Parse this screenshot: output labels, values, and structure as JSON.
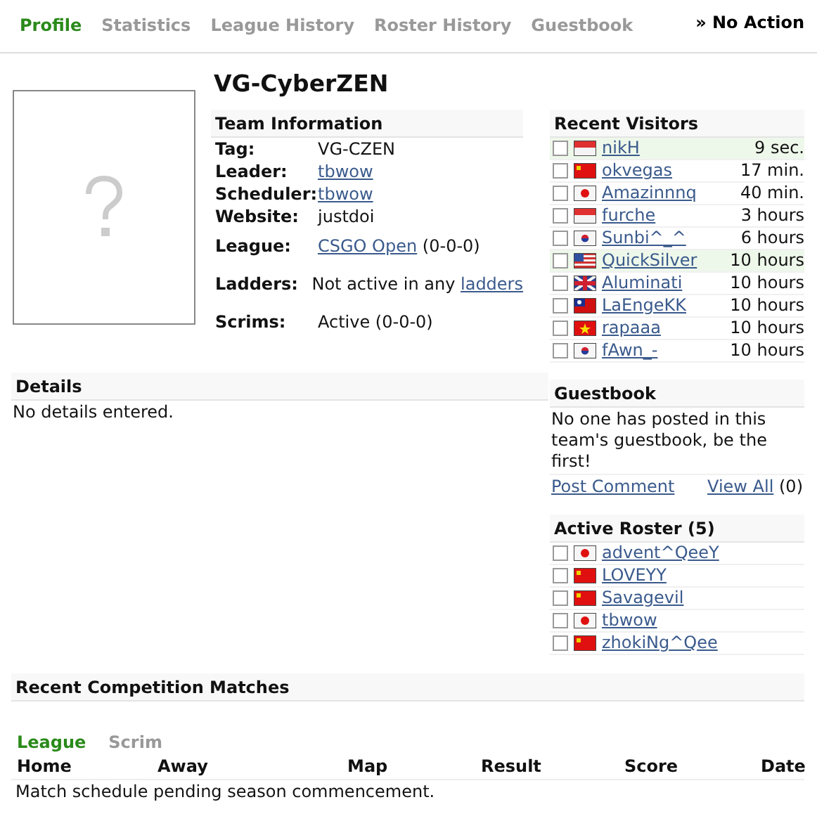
{
  "tabs": [
    {
      "label": "Profile",
      "selected": true
    },
    {
      "label": "Statistics",
      "selected": false
    },
    {
      "label": "League History",
      "selected": false
    },
    {
      "label": "Roster History",
      "selected": false
    },
    {
      "label": "Guestbook",
      "selected": false
    }
  ],
  "action": "» No Action",
  "team_name": "VG-CyberZEN",
  "team_information": {
    "title": "Team Information",
    "fields": [
      {
        "label": "Tag:",
        "value": "VG-CZEN"
      },
      {
        "label": "Leader:",
        "link": "tbwow"
      },
      {
        "label": "Scheduler:",
        "link": "tbwow"
      },
      {
        "label": "Website:",
        "value": "justdoi"
      },
      {
        "label": "League:",
        "link": "CSGO Open",
        "value": "(0-0-0)"
      },
      {
        "label": "Ladders:",
        "value": "Not active in any",
        "link": "ladders"
      },
      {
        "label": "Scrims:",
        "value": "Active (0-0-0)"
      }
    ]
  },
  "details": {
    "title": "Details",
    "text": "No details entered."
  },
  "recent_visitors": {
    "title": "Recent Visitors",
    "rows": [
      {
        "name": "nikH",
        "time": "9 sec.",
        "kind": "id",
        "checked": false,
        "highlighted": true
      },
      {
        "name": "okvegas",
        "time": "17 min.",
        "kind": "cn",
        "checked": false,
        "highlighted": false
      },
      {
        "name": "Amazinnnq",
        "time": "40 min.",
        "kind": "jp",
        "checked": false,
        "highlighted": false
      },
      {
        "name": "furche",
        "time": "3 hours",
        "kind": "id",
        "checked": false,
        "highlighted": false
      },
      {
        "name": "Sunbi^_^",
        "time": "6 hours",
        "kind": "kr",
        "checked": false,
        "highlighted": false
      },
      {
        "name": "QuickSilver",
        "time": "10 hours",
        "kind": "us",
        "checked": false,
        "highlighted": true
      },
      {
        "name": "Aluminati",
        "time": "10 hours",
        "kind": "gb",
        "checked": false,
        "highlighted": false
      },
      {
        "name": "LaEngeKK",
        "time": "10 hours",
        "kind": "tw",
        "checked": false,
        "highlighted": false
      },
      {
        "name": "rapaaa",
        "time": "10 hours",
        "kind": "vn",
        "checked": false,
        "highlighted": false
      },
      {
        "name": "fAwn_-",
        "time": "10 hours",
        "kind": "kr",
        "checked": false,
        "highlighted": false
      }
    ]
  },
  "guestbook": {
    "title": "Guestbook",
    "text": "No one has posted in this team's guestbook, be the first!",
    "post_link": "Post Comment",
    "view_link": "View All",
    "count": "(0)"
  },
  "active_roster": {
    "title": "Active Roster (5)",
    "rows": [
      {
        "name": "advent^QeeY",
        "kind": "jp",
        "checked": false
      },
      {
        "name": "LOVEYY",
        "kind": "cn",
        "checked": false
      },
      {
        "name": "Savagevil",
        "kind": "cn",
        "checked": false
      },
      {
        "name": "tbwow",
        "kind": "jp",
        "checked": false
      },
      {
        "name": "zhokiNg^Qee",
        "kind": "cn",
        "checked": false
      }
    ]
  },
  "matches": {
    "title": "Recent Competition Matches",
    "tabs": [
      {
        "label": "League",
        "selected": true
      },
      {
        "label": "Scrim",
        "selected": false
      }
    ],
    "columns": [
      "Home",
      "Away",
      "Map",
      "Result",
      "Score",
      "Date"
    ],
    "message": "Match schedule pending season commencement."
  }
}
